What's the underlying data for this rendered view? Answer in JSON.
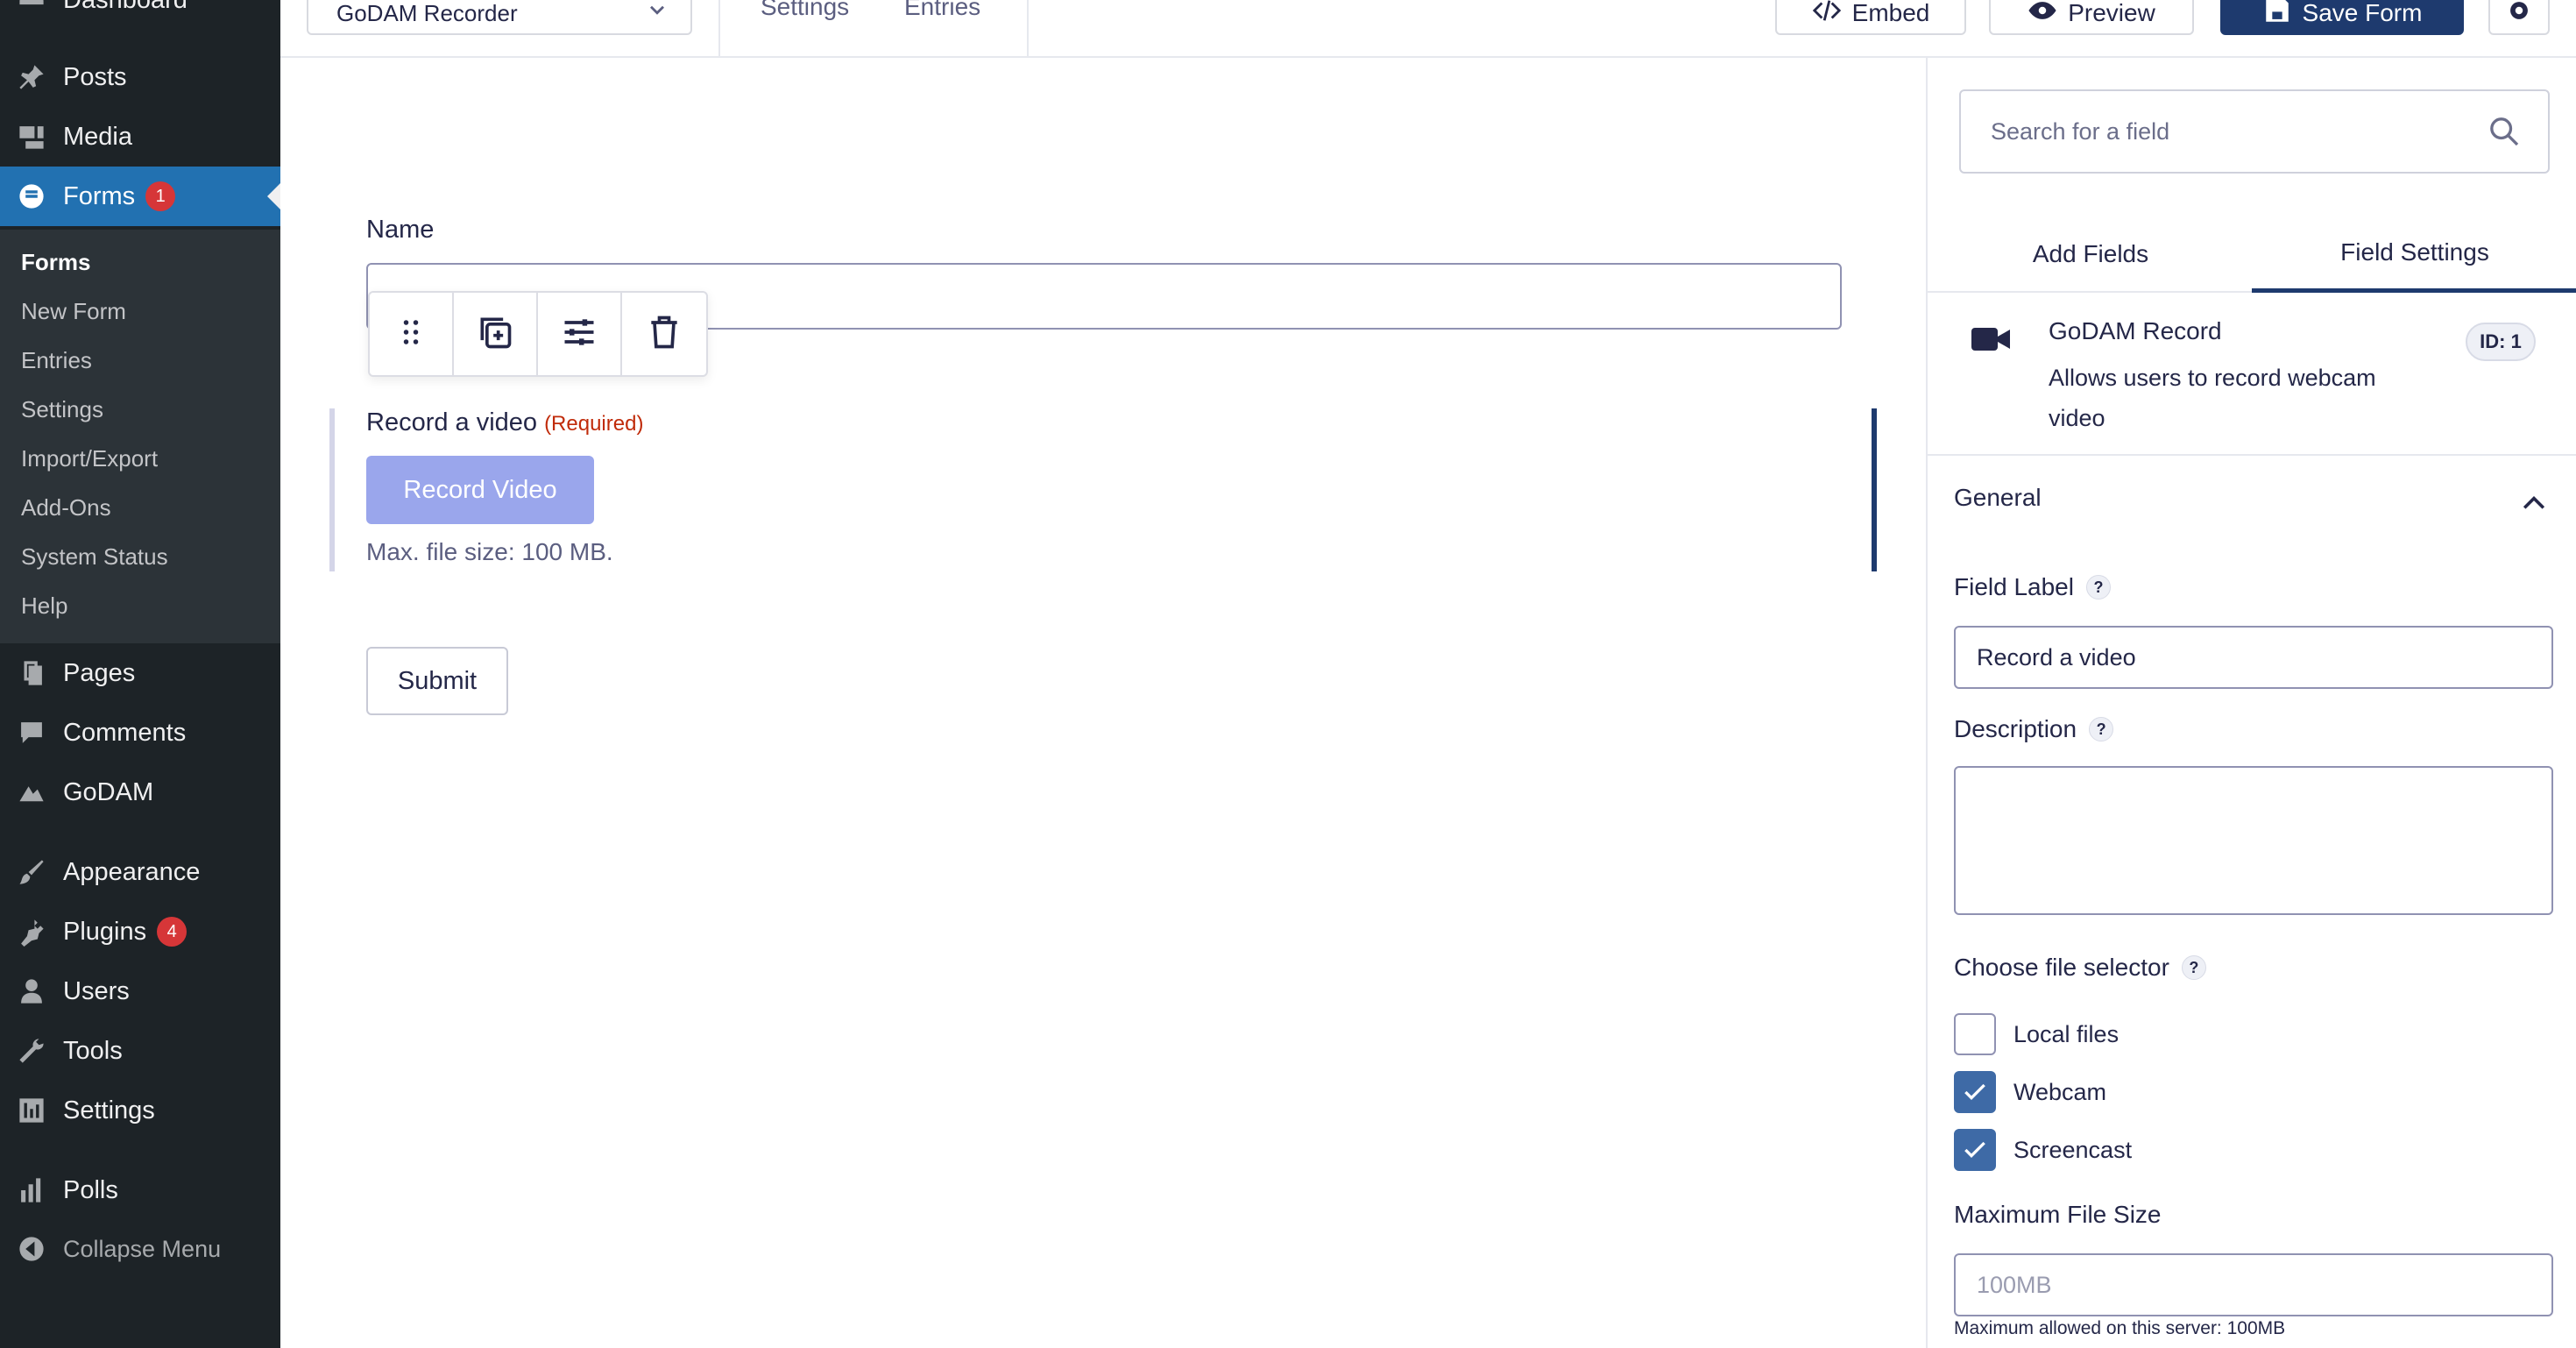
{
  "sidebar": {
    "items": [
      {
        "label": "Dashboard",
        "icon": "dashboard-icon"
      },
      {
        "label": "Posts",
        "icon": "pin-icon"
      },
      {
        "label": "Media",
        "icon": "media-icon"
      },
      {
        "label": "Forms",
        "icon": "forms-icon",
        "badge": "1",
        "active": true
      },
      {
        "label": "Pages",
        "icon": "pages-icon"
      },
      {
        "label": "Comments",
        "icon": "comment-icon"
      },
      {
        "label": "GoDAM",
        "icon": "godam-icon"
      },
      {
        "label": "Appearance",
        "icon": "brush-icon"
      },
      {
        "label": "Plugins",
        "icon": "plug-icon",
        "badge": "4"
      },
      {
        "label": "Users",
        "icon": "user-icon"
      },
      {
        "label": "Tools",
        "icon": "wrench-icon"
      },
      {
        "label": "Settings",
        "icon": "settings-icon"
      },
      {
        "label": "Polls",
        "icon": "bar-chart-icon"
      },
      {
        "label": "Collapse Menu",
        "icon": "collapse-icon"
      }
    ],
    "submenu": [
      "Forms",
      "New Form",
      "Entries",
      "Settings",
      "Import/Export",
      "Add-Ons",
      "System Status",
      "Help"
    ]
  },
  "topbar": {
    "form_select": "GoDAM Recorder",
    "links": [
      "Settings",
      "Entries"
    ],
    "embed": "Embed",
    "preview": "Preview",
    "save": "Save Form"
  },
  "form": {
    "name_label": "Name",
    "record_label": "Record a video",
    "required": "(Required)",
    "record_button": "Record Video",
    "max_size": "Max. file size: 100 MB.",
    "submit": "Submit"
  },
  "panel": {
    "search_placeholder": "Search for a field",
    "tabs": [
      "Add Fields",
      "Field Settings"
    ],
    "field_title": "GoDAM Record",
    "field_desc": "Allows users to record webcam video",
    "field_id": "ID: 1",
    "section": "General",
    "field_label_title": "Field Label",
    "field_label_value": "Record a video",
    "description_title": "Description",
    "file_selector_title": "Choose file selector",
    "options": [
      {
        "label": "Local files",
        "checked": false
      },
      {
        "label": "Webcam",
        "checked": true
      },
      {
        "label": "Screencast",
        "checked": true
      }
    ],
    "max_file_size_title": "Maximum File Size",
    "max_file_size_placeholder": "100MB",
    "max_file_size_hint": "Maximum allowed on this server: 100MB"
  },
  "colors": {
    "sidebar_bg": "#1d2327",
    "active_menu": "#2271b1",
    "primary_button": "#1e3a6e",
    "record_button": "#9aa6ec",
    "checkbox_checked": "#3e6aa6",
    "badge": "#d63638"
  }
}
